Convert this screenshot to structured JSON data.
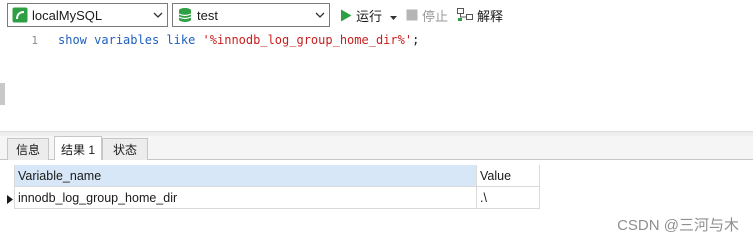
{
  "toolbar": {
    "connection": "localMySQL",
    "database": "test",
    "run_label": "运行",
    "stop_label": "停止",
    "explain_label": "解释"
  },
  "editor": {
    "line_number": "1",
    "code": {
      "kw1": "show",
      "kw2": "variables",
      "kw3": "like",
      "str": "'%innodb_log_group_home_dir%'",
      "end": ";"
    }
  },
  "tabs": [
    "信息",
    "结果 1",
    "状态"
  ],
  "results": {
    "columns": [
      "Variable_name",
      "Value"
    ],
    "rows": [
      [
        "innodb_log_group_home_dir",
        ".\\"
      ]
    ]
  },
  "watermark": "CSDN @三河与木",
  "colors": {
    "accent_green": "#2ea043",
    "keyword_blue": "#1f5fbf",
    "string_red": "#c81e1e",
    "header_blue": "#d7e7f7"
  }
}
